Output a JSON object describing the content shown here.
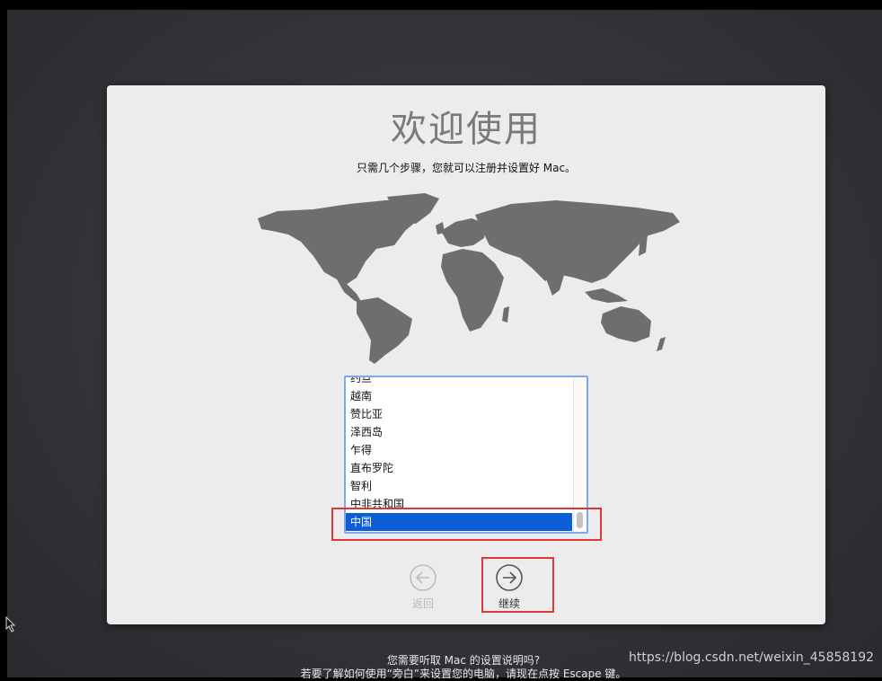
{
  "welcome": {
    "title": "欢迎使用",
    "subtitle": "只需几个步骤，您就可以注册并设置好 Mac。"
  },
  "country_list": {
    "items": [
      "约旦",
      "越南",
      "赞比亚",
      "泽西岛",
      "乍得",
      "直布罗陀",
      "智利",
      "中非共和国",
      "中国"
    ],
    "selected": "中国",
    "selected_color": "#0c5fd6"
  },
  "nav": {
    "back_label": "返回",
    "continue_label": "继续",
    "back_icon": "arrow-left-circle-icon",
    "continue_icon": "arrow-right-circle-icon"
  },
  "footer": {
    "line1": "您需要听取 Mac 的设置说明吗?",
    "line2": "若要了解如何使用“旁白”来设置您的电脑，请现在点按 Escape 键。"
  },
  "watermark": "https://blog.csdn.net/weixin_45858192",
  "colors": {
    "annotation": "#e03535",
    "panel": "#ececec",
    "map": "#6e6e6e"
  }
}
